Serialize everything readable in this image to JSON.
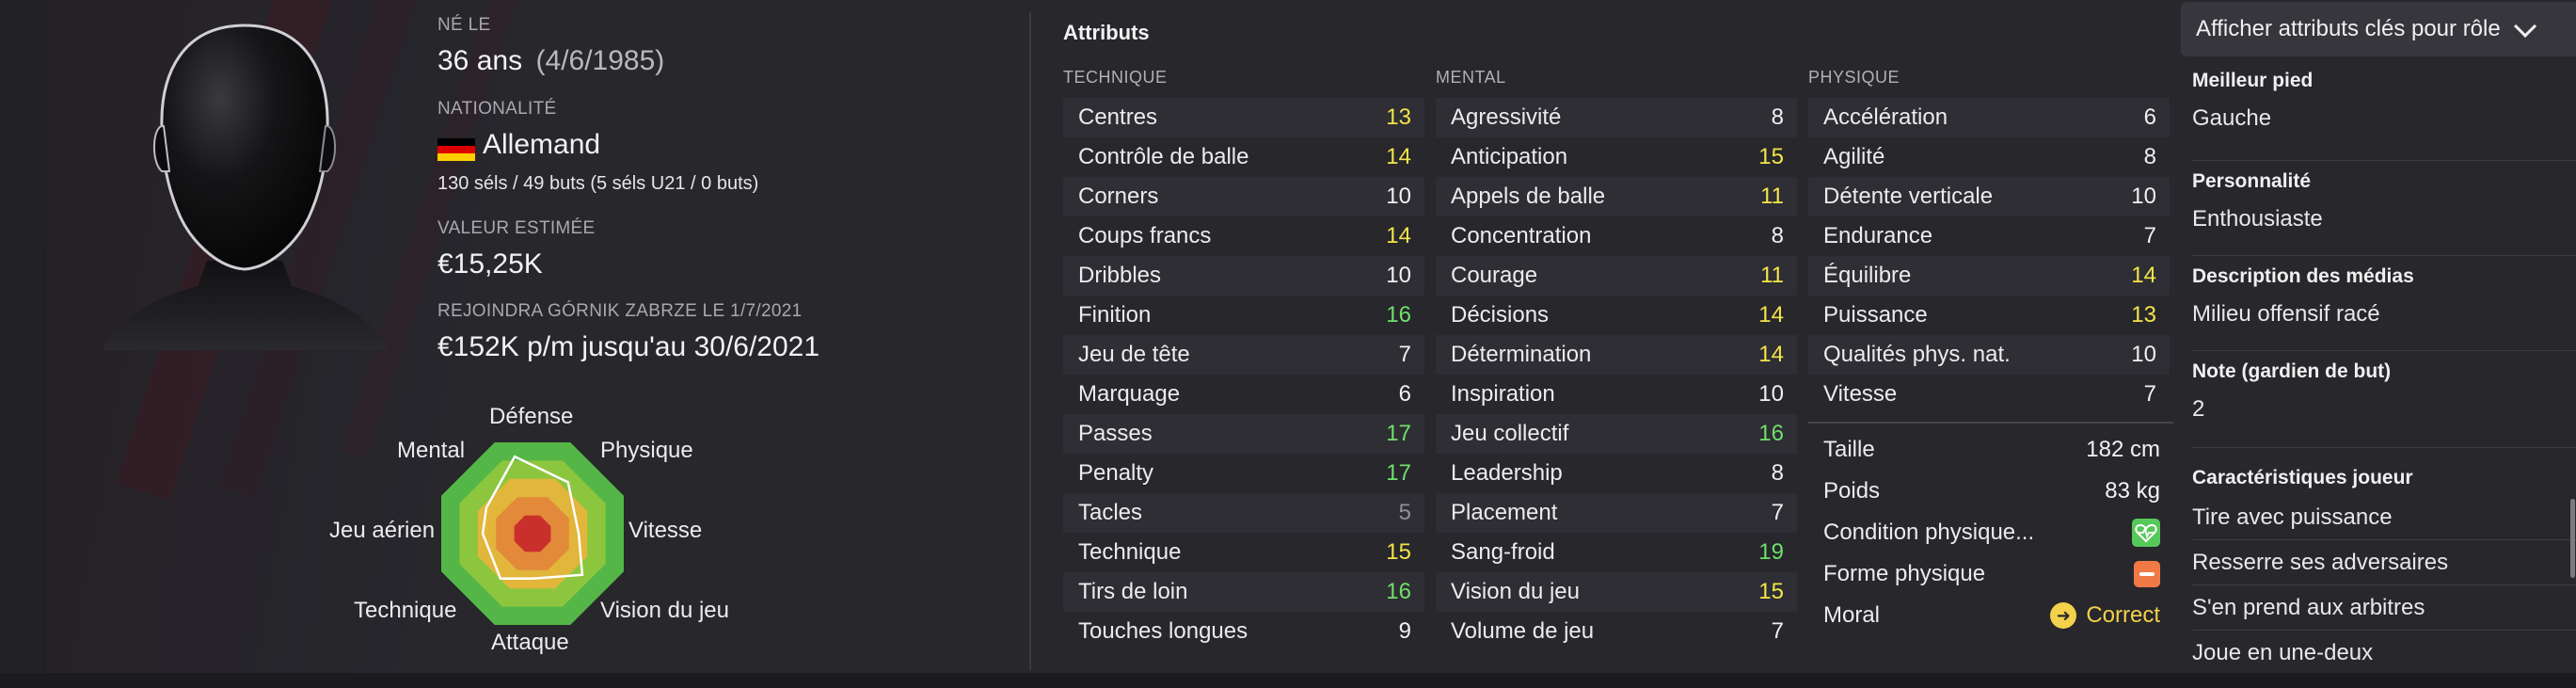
{
  "player": {
    "born_label": "NÉ LE",
    "age": "36 ans",
    "birth_date": "(4/6/1985)",
    "nationality_label": "NATIONALITÉ",
    "nationality": "Allemand",
    "caps": "130 séls / 49 buts (5 séls U21 / 0 buts)",
    "value_label": "VALEUR ESTIMÉE",
    "value": "€15,25K",
    "transfer_label": "REJOINDRA GÓRNIK ZABRZE LE 1/7/2021",
    "contract": "€152K p/m jusqu'au 30/6/2021"
  },
  "radar": {
    "labels": {
      "defense": "Défense",
      "physique": "Physique",
      "vitesse": "Vitesse",
      "vision": "Vision du jeu",
      "attaque": "Attaque",
      "technique": "Technique",
      "aerien": "Jeu aérien",
      "mental": "Mental"
    },
    "colors": [
      "#54b646",
      "#8cc63f",
      "#e2b53b",
      "#e38a3a",
      "#c9302c"
    ]
  },
  "attributes": {
    "title": "Attributs",
    "technique_header": "TECHNIQUE",
    "mental_header": "MENTAL",
    "physique_header": "PHYSIQUE",
    "technique": [
      {
        "name": "Centres",
        "value": "13",
        "level": "yellow"
      },
      {
        "name": "Contrôle de balle",
        "value": "14",
        "level": "yellow"
      },
      {
        "name": "Corners",
        "value": "10",
        "level": "white"
      },
      {
        "name": "Coups francs",
        "value": "14",
        "level": "yellow"
      },
      {
        "name": "Dribbles",
        "value": "10",
        "level": "white"
      },
      {
        "name": "Finition",
        "value": "16",
        "level": "green"
      },
      {
        "name": "Jeu de tête",
        "value": "7",
        "level": "white"
      },
      {
        "name": "Marquage",
        "value": "6",
        "level": "white"
      },
      {
        "name": "Passes",
        "value": "17",
        "level": "green"
      },
      {
        "name": "Penalty",
        "value": "17",
        "level": "green"
      },
      {
        "name": "Tacles",
        "value": "5",
        "level": "grey"
      },
      {
        "name": "Technique",
        "value": "15",
        "level": "yellow"
      },
      {
        "name": "Tirs de loin",
        "value": "16",
        "level": "green"
      },
      {
        "name": "Touches longues",
        "value": "9",
        "level": "white"
      }
    ],
    "mental": [
      {
        "name": "Agressivité",
        "value": "8",
        "level": "white"
      },
      {
        "name": "Anticipation",
        "value": "15",
        "level": "yellow"
      },
      {
        "name": "Appels de balle",
        "value": "11",
        "level": "yellow"
      },
      {
        "name": "Concentration",
        "value": "8",
        "level": "white"
      },
      {
        "name": "Courage",
        "value": "11",
        "level": "yellow"
      },
      {
        "name": "Décisions",
        "value": "14",
        "level": "yellow"
      },
      {
        "name": "Détermination",
        "value": "14",
        "level": "yellow"
      },
      {
        "name": "Inspiration",
        "value": "10",
        "level": "white"
      },
      {
        "name": "Jeu collectif",
        "value": "16",
        "level": "green"
      },
      {
        "name": "Leadership",
        "value": "8",
        "level": "white"
      },
      {
        "name": "Placement",
        "value": "7",
        "level": "white"
      },
      {
        "name": "Sang-froid",
        "value": "19",
        "level": "green"
      },
      {
        "name": "Vision du jeu",
        "value": "15",
        "level": "yellow"
      },
      {
        "name": "Volume de jeu",
        "value": "7",
        "level": "white"
      }
    ],
    "physique": [
      {
        "name": "Accélération",
        "value": "6",
        "level": "white"
      },
      {
        "name": "Agilité",
        "value": "8",
        "level": "white"
      },
      {
        "name": "Détente verticale",
        "value": "10",
        "level": "white"
      },
      {
        "name": "Endurance",
        "value": "7",
        "level": "white"
      },
      {
        "name": "Équilibre",
        "value": "14",
        "level": "yellow"
      },
      {
        "name": "Puissance",
        "value": "13",
        "level": "yellow"
      },
      {
        "name": "Qualités phys. nat.",
        "value": "10",
        "level": "white"
      },
      {
        "name": "Vitesse",
        "value": "7",
        "level": "white"
      }
    ],
    "height_label": "Taille",
    "height": "182 cm",
    "weight_label": "Poids",
    "weight": "83 kg",
    "condition_label": "Condition physique...",
    "form_label": "Forme physique",
    "morale_label": "Moral",
    "morale": "Correct"
  },
  "side_panel": {
    "role_select": "Afficher attributs clés pour rôle",
    "best_foot_label": "Meilleur pied",
    "best_foot": "Gauche",
    "personality_label": "Personnalité",
    "personality": "Enthousiaste",
    "media_label": "Description des médias",
    "media": "Milieu offensif racé",
    "gk_label": "Note (gardien de but)",
    "gk": "2",
    "traits_label": "Caractéristiques joueur",
    "traits": [
      "Tire avec puissance",
      "Resserre ses adversaires",
      "S'en prend aux arbitres",
      "Joue en une-deux"
    ]
  }
}
